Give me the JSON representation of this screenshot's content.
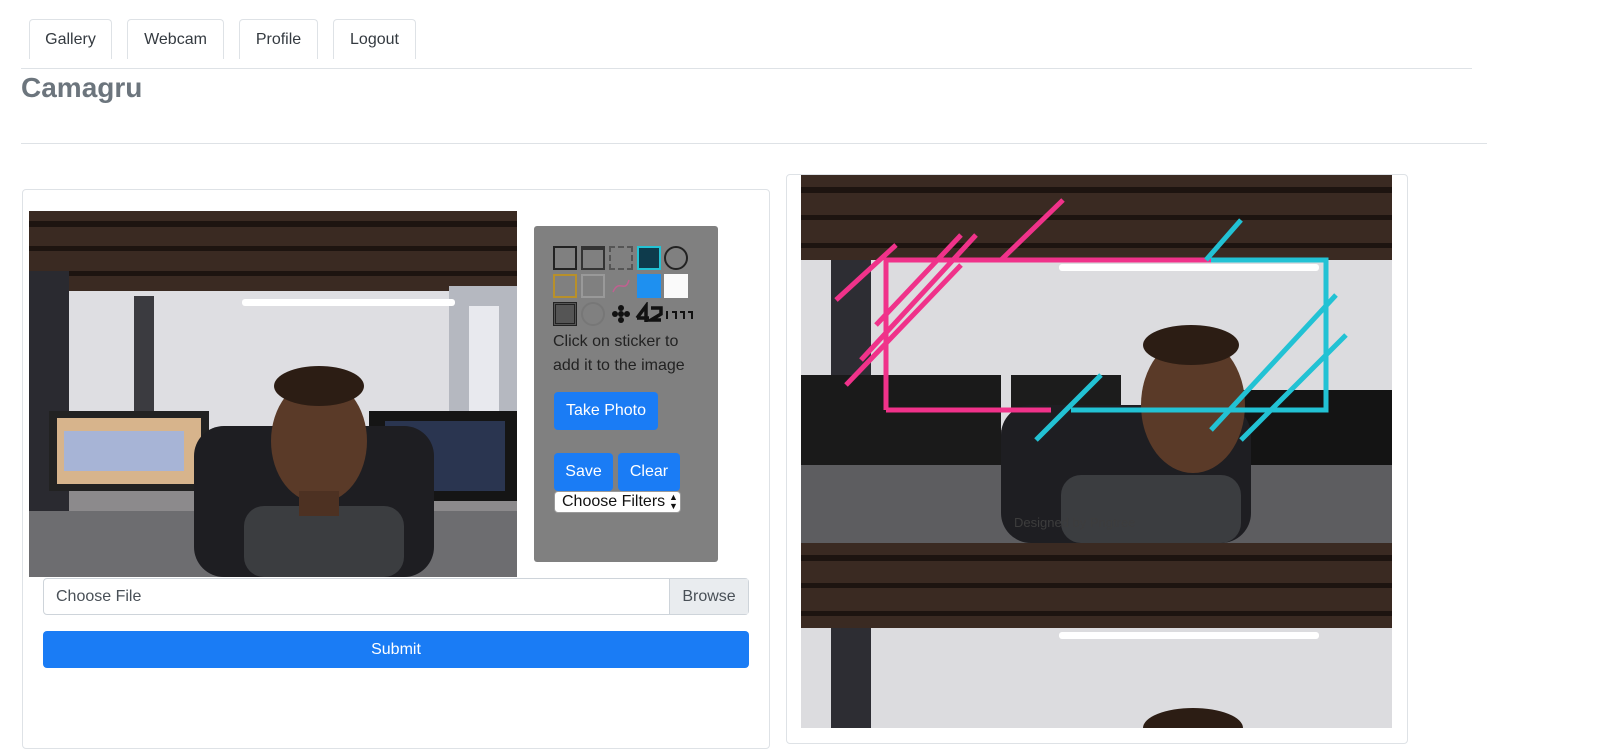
{
  "nav": {
    "tabs": [
      {
        "label": "Gallery"
      },
      {
        "label": "Webcam"
      },
      {
        "label": "Profile"
      },
      {
        "label": "Logout"
      }
    ]
  },
  "brand": "Camagru",
  "stickers": {
    "items": [
      "frame-sticker",
      "frame-sticker",
      "frame-sticker",
      "card-sticker",
      "speech-bubble-sticker",
      "frame-sticker",
      "frame-sticker",
      "swirl-sticker",
      "app-card-sticker",
      "note-sticker",
      "frame-sticker",
      "wreath-sticker",
      "flower-sticker",
      "logo-42-sticker",
      "leet-sticker"
    ],
    "hint": "Click on sticker to add it to the image"
  },
  "controls": {
    "take_photo": "Take Photo",
    "save": "Save",
    "clear": "Clear",
    "filter_select": "Choose Filters"
  },
  "upload": {
    "file_label": "Choose File",
    "browse": "Browse",
    "submit": "Submit"
  },
  "preview": {
    "watermark": "Designed by Pngtree"
  },
  "colors": {
    "primary": "#1a7cf5",
    "sticker_panel": "#808080",
    "pink_overlay": "#f0328a",
    "cyan_overlay": "#22c2d4"
  }
}
